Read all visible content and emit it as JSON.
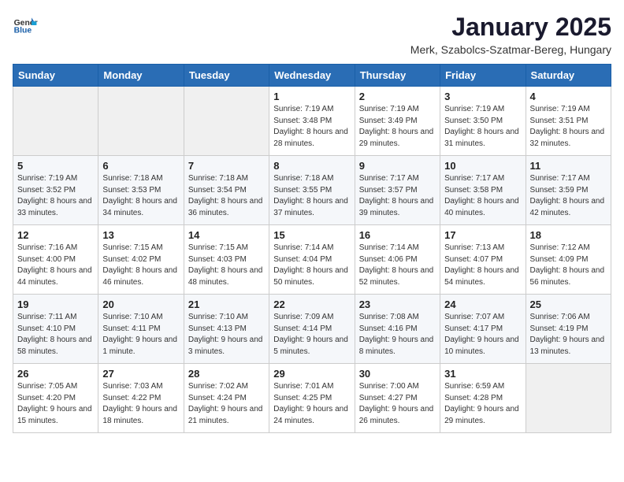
{
  "header": {
    "logo_general": "General",
    "logo_blue": "Blue",
    "month_title": "January 2025",
    "location": "Merk, Szabolcs-Szatmar-Bereg, Hungary"
  },
  "days_of_week": [
    "Sunday",
    "Monday",
    "Tuesday",
    "Wednesday",
    "Thursday",
    "Friday",
    "Saturday"
  ],
  "weeks": [
    [
      {
        "day": "",
        "info": ""
      },
      {
        "day": "",
        "info": ""
      },
      {
        "day": "",
        "info": ""
      },
      {
        "day": "1",
        "info": "Sunrise: 7:19 AM\nSunset: 3:48 PM\nDaylight: 8 hours and 28 minutes."
      },
      {
        "day": "2",
        "info": "Sunrise: 7:19 AM\nSunset: 3:49 PM\nDaylight: 8 hours and 29 minutes."
      },
      {
        "day": "3",
        "info": "Sunrise: 7:19 AM\nSunset: 3:50 PM\nDaylight: 8 hours and 31 minutes."
      },
      {
        "day": "4",
        "info": "Sunrise: 7:19 AM\nSunset: 3:51 PM\nDaylight: 8 hours and 32 minutes."
      }
    ],
    [
      {
        "day": "5",
        "info": "Sunrise: 7:19 AM\nSunset: 3:52 PM\nDaylight: 8 hours and 33 minutes."
      },
      {
        "day": "6",
        "info": "Sunrise: 7:18 AM\nSunset: 3:53 PM\nDaylight: 8 hours and 34 minutes."
      },
      {
        "day": "7",
        "info": "Sunrise: 7:18 AM\nSunset: 3:54 PM\nDaylight: 8 hours and 36 minutes."
      },
      {
        "day": "8",
        "info": "Sunrise: 7:18 AM\nSunset: 3:55 PM\nDaylight: 8 hours and 37 minutes."
      },
      {
        "day": "9",
        "info": "Sunrise: 7:17 AM\nSunset: 3:57 PM\nDaylight: 8 hours and 39 minutes."
      },
      {
        "day": "10",
        "info": "Sunrise: 7:17 AM\nSunset: 3:58 PM\nDaylight: 8 hours and 40 minutes."
      },
      {
        "day": "11",
        "info": "Sunrise: 7:17 AM\nSunset: 3:59 PM\nDaylight: 8 hours and 42 minutes."
      }
    ],
    [
      {
        "day": "12",
        "info": "Sunrise: 7:16 AM\nSunset: 4:00 PM\nDaylight: 8 hours and 44 minutes."
      },
      {
        "day": "13",
        "info": "Sunrise: 7:15 AM\nSunset: 4:02 PM\nDaylight: 8 hours and 46 minutes."
      },
      {
        "day": "14",
        "info": "Sunrise: 7:15 AM\nSunset: 4:03 PM\nDaylight: 8 hours and 48 minutes."
      },
      {
        "day": "15",
        "info": "Sunrise: 7:14 AM\nSunset: 4:04 PM\nDaylight: 8 hours and 50 minutes."
      },
      {
        "day": "16",
        "info": "Sunrise: 7:14 AM\nSunset: 4:06 PM\nDaylight: 8 hours and 52 minutes."
      },
      {
        "day": "17",
        "info": "Sunrise: 7:13 AM\nSunset: 4:07 PM\nDaylight: 8 hours and 54 minutes."
      },
      {
        "day": "18",
        "info": "Sunrise: 7:12 AM\nSunset: 4:09 PM\nDaylight: 8 hours and 56 minutes."
      }
    ],
    [
      {
        "day": "19",
        "info": "Sunrise: 7:11 AM\nSunset: 4:10 PM\nDaylight: 8 hours and 58 minutes."
      },
      {
        "day": "20",
        "info": "Sunrise: 7:10 AM\nSunset: 4:11 PM\nDaylight: 9 hours and 1 minute."
      },
      {
        "day": "21",
        "info": "Sunrise: 7:10 AM\nSunset: 4:13 PM\nDaylight: 9 hours and 3 minutes."
      },
      {
        "day": "22",
        "info": "Sunrise: 7:09 AM\nSunset: 4:14 PM\nDaylight: 9 hours and 5 minutes."
      },
      {
        "day": "23",
        "info": "Sunrise: 7:08 AM\nSunset: 4:16 PM\nDaylight: 9 hours and 8 minutes."
      },
      {
        "day": "24",
        "info": "Sunrise: 7:07 AM\nSunset: 4:17 PM\nDaylight: 9 hours and 10 minutes."
      },
      {
        "day": "25",
        "info": "Sunrise: 7:06 AM\nSunset: 4:19 PM\nDaylight: 9 hours and 13 minutes."
      }
    ],
    [
      {
        "day": "26",
        "info": "Sunrise: 7:05 AM\nSunset: 4:20 PM\nDaylight: 9 hours and 15 minutes."
      },
      {
        "day": "27",
        "info": "Sunrise: 7:03 AM\nSunset: 4:22 PM\nDaylight: 9 hours and 18 minutes."
      },
      {
        "day": "28",
        "info": "Sunrise: 7:02 AM\nSunset: 4:24 PM\nDaylight: 9 hours and 21 minutes."
      },
      {
        "day": "29",
        "info": "Sunrise: 7:01 AM\nSunset: 4:25 PM\nDaylight: 9 hours and 24 minutes."
      },
      {
        "day": "30",
        "info": "Sunrise: 7:00 AM\nSunset: 4:27 PM\nDaylight: 9 hours and 26 minutes."
      },
      {
        "day": "31",
        "info": "Sunrise: 6:59 AM\nSunset: 4:28 PM\nDaylight: 9 hours and 29 minutes."
      },
      {
        "day": "",
        "info": ""
      }
    ]
  ]
}
